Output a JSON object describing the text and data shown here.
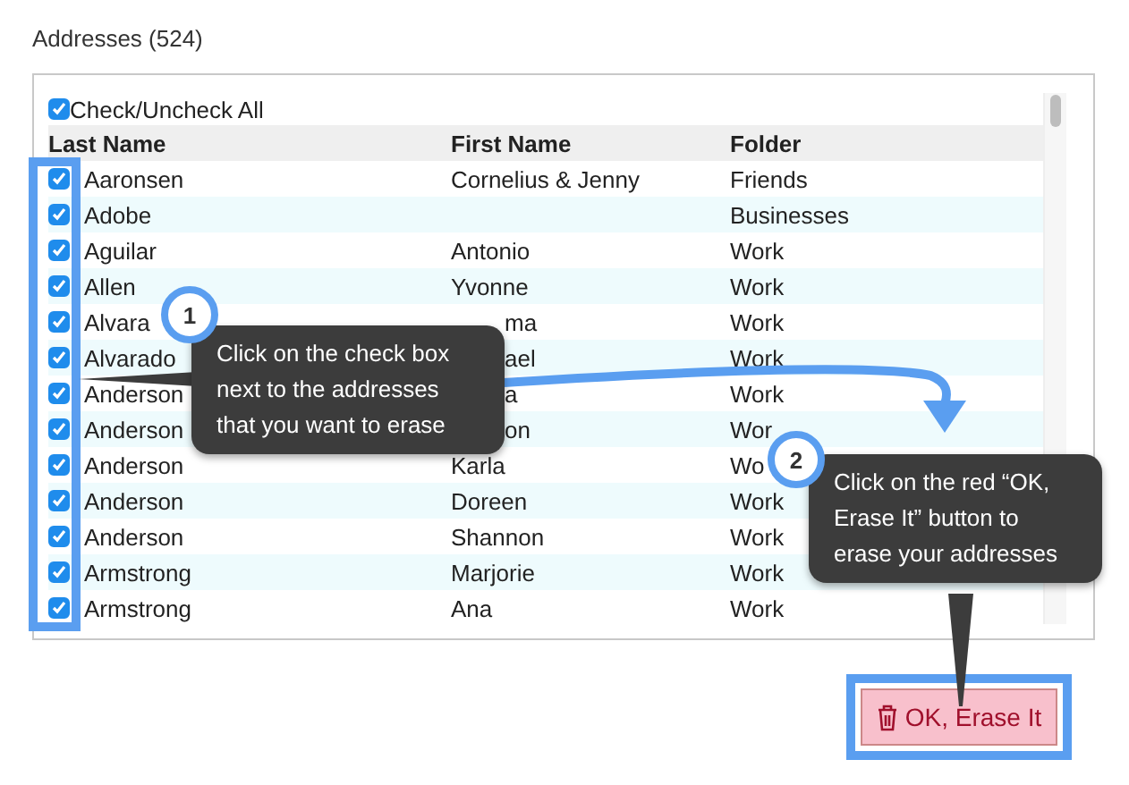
{
  "title": "Addresses (524)",
  "check_all": {
    "label": "Check/Uncheck All",
    "checked": true
  },
  "columns": [
    "Last Name",
    "First Name",
    "Folder"
  ],
  "rows": [
    {
      "checked": true,
      "last_name": "Aaronsen",
      "first_name": "Cornelius & Jenny",
      "first_name_cut": false,
      "folder": "Friends"
    },
    {
      "checked": true,
      "last_name": "Adobe",
      "folder": "Businesses"
    },
    {
      "checked": true,
      "last_name": "Aguilar",
      "first_name": "Antonio",
      "first_name_cut": false,
      "folder": "Work"
    },
    {
      "checked": true,
      "last_name": "Allen",
      "first_name": "Yvonne",
      "first_name_cut": false,
      "folder": "Work"
    },
    {
      "checked": true,
      "last_name": "Alvara",
      "first_name": "ma",
      "first_name_cut": true,
      "folder": "Work"
    },
    {
      "checked": true,
      "last_name": "Alvarado",
      "first_name": "ael",
      "first_name_cut": true,
      "folder": "Work"
    },
    {
      "checked": true,
      "last_name": "Anderson",
      "first_name": "a",
      "first_name_cut": true,
      "folder": "Work"
    },
    {
      "checked": true,
      "last_name": "Anderson",
      "first_name": "on",
      "first_name_cut": true,
      "folder": "Wor"
    },
    {
      "checked": true,
      "last_name": "Anderson",
      "first_name": "Karla",
      "first_name_cut": false,
      "folder": "Wo"
    },
    {
      "checked": true,
      "last_name": "Anderson",
      "first_name": "Doreen",
      "first_name_cut": false,
      "folder": "Work"
    },
    {
      "checked": true,
      "last_name": "Anderson",
      "first_name": "Shannon",
      "first_name_cut": false,
      "folder": "Work"
    },
    {
      "checked": true,
      "last_name": "Armstrong",
      "first_name": "Marjorie",
      "first_name_cut": false,
      "folder": "Work"
    },
    {
      "checked": true,
      "last_name": "Armstrong",
      "first_name": "Ana",
      "first_name_cut": false,
      "folder": "Work"
    }
  ],
  "callouts": [
    {
      "number": "1",
      "text": "Click on the check box next to the addresses that you want to erase"
    },
    {
      "number": "2",
      "text": "Click on the red “OK, Erase It” button to erase your addresses"
    }
  ],
  "erase_button": {
    "label": "OK, Erase It"
  }
}
